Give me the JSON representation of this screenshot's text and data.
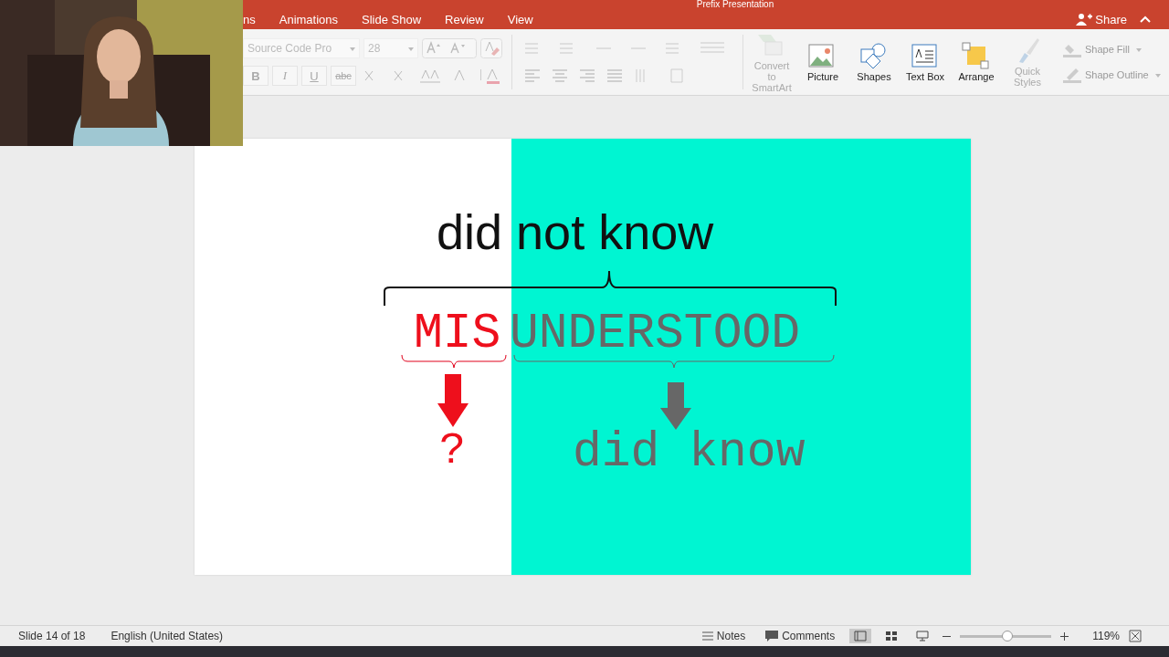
{
  "window": {
    "title": "Prefix Presentation"
  },
  "menu_tabs": [
    {
      "label": "ns",
      "selected": false
    },
    {
      "label": "Animations",
      "selected": false
    },
    {
      "label": "Slide Show",
      "selected": false
    },
    {
      "label": "Review",
      "selected": false
    },
    {
      "label": "View",
      "selected": false
    }
  ],
  "share": {
    "label": "Share"
  },
  "ribbon": {
    "font_name": "Source Code Pro",
    "font_size": "28",
    "format_buttons": [
      "B",
      "I",
      "U",
      "abc"
    ],
    "tools": [
      {
        "label": "Convert to SmartArt",
        "kind": "smartart",
        "disabled": true
      },
      {
        "label": "Picture",
        "kind": "picture",
        "disabled": false
      },
      {
        "label": "Shapes",
        "kind": "shapes",
        "disabled": false
      },
      {
        "label": "Text Box",
        "kind": "textbox",
        "disabled": false
      },
      {
        "label": "Arrange",
        "kind": "arrange",
        "disabled": false
      },
      {
        "label": "Quick Styles",
        "kind": "styles",
        "disabled": true
      }
    ],
    "shape_options": [
      {
        "label": "Shape Fill",
        "kind": "fill",
        "disabled": true
      },
      {
        "label": "Shape Outline",
        "kind": "outline",
        "disabled": true
      }
    ]
  },
  "slide": {
    "title": "did not know",
    "prefix": "MIS",
    "root": "UNDERSTOOD",
    "prefix_meaning": "?",
    "root_meaning": "did know"
  },
  "status_bar": {
    "slide": "Slide 14 of 18",
    "language": "English (United States)",
    "notes": "Notes",
    "comments": "Comments",
    "views": [
      {
        "selected": true
      },
      {
        "selected": false
      },
      {
        "selected": false
      }
    ],
    "zoom": {
      "level": 0.51
    },
    "zoom_reading": "119%"
  }
}
